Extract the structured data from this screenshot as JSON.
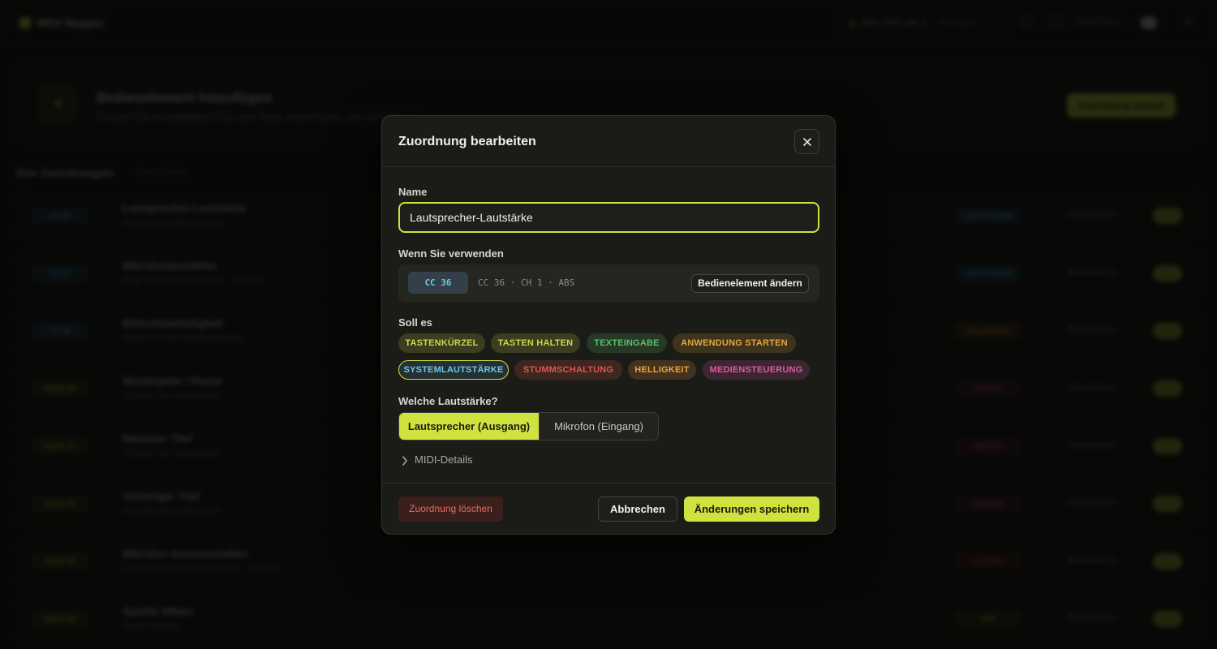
{
  "background": {
    "app_title": "MIDI Mapper",
    "device": {
      "name": "SMC-TRG MK II",
      "sub": "Verbunden"
    },
    "language": "DEUTSCH",
    "add_card": {
      "title": "Bedienelement hinzufügen",
      "subtitle": "Drücken Sie ein beliebiges Pad, eine Taste, einen Regler oder einen Fader",
      "button": "Zuordnung starten"
    },
    "list": {
      "title": "Ihre Zuordnungen",
      "count": "8 von 8 aktiv",
      "edit_label": "Bearbeiten"
    },
    "rows": [
      {
        "trigger": "CC 36",
        "name": "Lautsprecher-Lautstärke",
        "sub": "Folgt dem Bedienelement",
        "badge": "LAUTSTÄRKE"
      },
      {
        "trigger": "CC 37",
        "name": "Mikrofonlautstärke",
        "sub": "Folgt dem Bedienelement · Mikrofon",
        "badge": "LAUTSTÄRKE"
      },
      {
        "trigger": "CC 38",
        "name": "Bildschirmhelligkeit",
        "sub": "Stellt sich dem Bedienelement",
        "badge": "HELLIGKEIT"
      },
      {
        "trigger": "NOTE 36",
        "name": "Wiedergabe / Pause",
        "sub": "Schaltet die Medientaste",
        "badge": "MEDIEN"
      },
      {
        "trigger": "NOTE 37",
        "name": "Nächster Titel",
        "sub": "Schaltet die Medientaste",
        "badge": "MEDIEN"
      },
      {
        "trigger": "NOTE 38",
        "name": "Vorheriger Titel",
        "sub": "Schaltet die Medientaste",
        "badge": "MEDIEN"
      },
      {
        "trigger": "NOTE 39",
        "name": "Mikrofon stummschalten",
        "sub": "Umschalten zwischen stumm · Mikrofon",
        "badge": "STUMM"
      },
      {
        "trigger": "NOTE 40",
        "name": "Spotify öffnen",
        "sub": "Startet Spotify",
        "badge": "APP"
      }
    ]
  },
  "modal": {
    "title": "Zuordnung bearbeiten",
    "name_label": "Name",
    "name_value": "Lautsprecher-Lautstärke",
    "trigger_label": "Wenn Sie verwenden",
    "trigger_chip": "CC 36",
    "trigger_details": "CC 36 · CH 1 · ABS",
    "change_button": "Bedienelement ändern",
    "action_label": "Soll es",
    "actions": [
      {
        "label": "TASTENKÜRZEL",
        "color": "#c9d84a"
      },
      {
        "label": "TASTEN HALTEN",
        "color": "#c9d84a"
      },
      {
        "label": "TEXTEINGABE",
        "color": "#5cbf6a"
      },
      {
        "label": "ANWENDUNG STARTEN",
        "color": "#e0a93a"
      },
      {
        "label": "SYSTEMLAUTSTÄRKE",
        "color": "#6fc6e6",
        "selected": true
      },
      {
        "label": "STUMMSCHALTUNG",
        "color": "#e0564c"
      },
      {
        "label": "HELLIGKEIT",
        "color": "#f0a042"
      },
      {
        "label": "MEDIENSTEUERUNG",
        "color": "#d85aa4"
      }
    ],
    "volume_label": "Welche Lautstärke?",
    "volume_options": [
      {
        "label": "Lautsprecher (Ausgang)",
        "selected": true
      },
      {
        "label": "Mikrofon (Eingang)",
        "selected": false
      }
    ],
    "midi_details": "MIDI-Details",
    "delete_button": "Zuordnung löschen",
    "cancel_button": "Abbrechen",
    "save_button": "Änderungen speichern"
  },
  "colors": {
    "accent": "#cfe23e",
    "danger": "#e56c5e",
    "cc": "#6fc6e6"
  }
}
